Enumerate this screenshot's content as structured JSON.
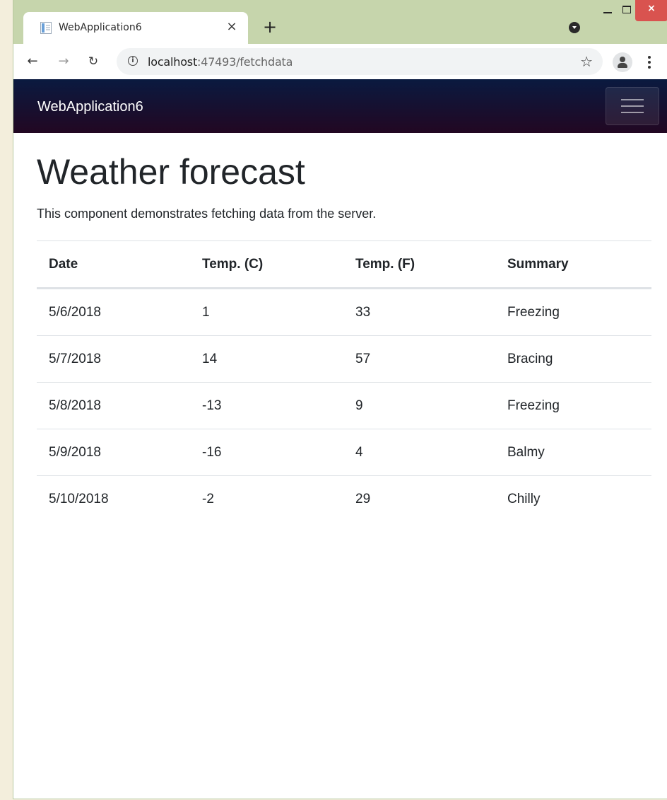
{
  "browser": {
    "tab_title": "WebApplication6",
    "tab_close": "×",
    "new_tab": "+",
    "url_host": "localhost",
    "url_path": ":47493/fetchdata",
    "close_glyph": "×"
  },
  "app": {
    "brand": "WebApplication6"
  },
  "page": {
    "title": "Weather forecast",
    "description": "This component demonstrates fetching data from the server."
  },
  "table": {
    "columns": [
      "Date",
      "Temp. (C)",
      "Temp. (F)",
      "Summary"
    ],
    "rows": [
      [
        "5/6/2018",
        "1",
        "33",
        "Freezing"
      ],
      [
        "5/7/2018",
        "14",
        "57",
        "Bracing"
      ],
      [
        "5/8/2018",
        "-13",
        "9",
        "Freezing"
      ],
      [
        "5/9/2018",
        "-16",
        "4",
        "Balmy"
      ],
      [
        "5/10/2018",
        "-2",
        "29",
        "Chilly"
      ]
    ]
  },
  "icons": {
    "favicon": "page-icon",
    "back": "arrow-left-icon",
    "forward": "arrow-right-icon",
    "reload": "reload-icon",
    "info": "info-icon",
    "bookmark": "star-icon",
    "account": "account-icon",
    "menu": "kebab-menu-icon",
    "navbar_toggle": "hamburger-icon"
  },
  "colors": {
    "tabstrip": "#c6d5ac",
    "navbar_top": "#0a1a40",
    "navbar_bottom": "#220722",
    "close_button": "#d9534f"
  }
}
